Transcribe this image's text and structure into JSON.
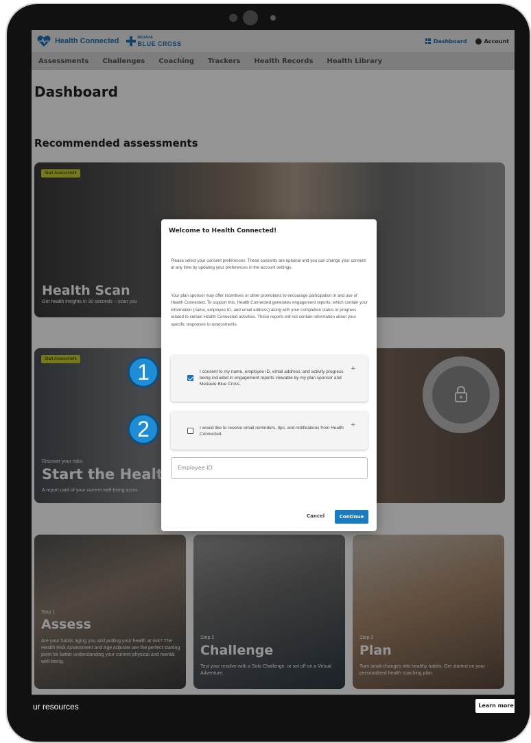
{
  "header": {
    "brand": "Health Connected",
    "partner_small": "MEDAVIE",
    "partner": "BLUE CROSS",
    "dashboard_link": "Dashboard",
    "account_link": "Account"
  },
  "nav": {
    "items": [
      "Assessments",
      "Challenges",
      "Coaching",
      "Trackers",
      "Health Records",
      "Health Library"
    ]
  },
  "page": {
    "title": "Dashboard",
    "section_title": "Recommended assessments"
  },
  "cards": {
    "health_scan": {
      "badge": "Start Assessment",
      "title": "Health Scan",
      "subtitle": "Get health insights in 30 seconds – scan you"
    },
    "hra": {
      "badge": "Start Assessment",
      "kicker": "Discover your risks",
      "title": "Start the Health R",
      "subtitle": "A report card of your current well-being acros"
    },
    "steps": [
      {
        "step": "Step 1",
        "title": "Assess",
        "text": "Are your habits aging you and putting your health at risk? The Health Risk Assessment and Age Adjuster are the perfect starting point for better understanding your current physical and mental well-being."
      },
      {
        "step": "Step 2",
        "title": "Challenge",
        "text": "Test your resolve with a Solo Challenge, or set off on a Virtual Adventure."
      },
      {
        "step": "Step 3",
        "title": "Plan",
        "text": "Turn small changes into healthy habits. Get started on your personalized health coaching plan."
      }
    ]
  },
  "resources": {
    "title": "ur resources",
    "learn_more": "Learn more"
  },
  "dialog": {
    "title": "Welcome to Health Connected!",
    "intro": "Please select your consent preferences. These consents are optional and you can change your consent at any time by updating your preferences in the account settings.",
    "body": "Your plan sponsor may offer incentives or other promotions to encourage participation in and use of Health Connected. To support this, Health Connected generates engagement reports, which contain your information (name, employee ID, and email address) along with your completion status or progress related to certain Health Connected activities. These reports will not contain information about your specific responses to assessments.",
    "consent1": {
      "text": "I consent to my name, employee ID, email address, and activity progress being included in engagement reports viewable by my plan sponsor and Medavie Blue Cross.",
      "checked": true
    },
    "consent2": {
      "text": "I would like to receive email reminders, tips, and notifications from Health Connected.",
      "checked": false
    },
    "employee_id_placeholder": "Employee ID",
    "cancel": "Cancel",
    "continue": "Continue",
    "expand_symbol": "+"
  },
  "callouts": [
    "1",
    "2"
  ],
  "colors": {
    "brand_blue": "#1f72b8",
    "continue_button": "#1a7bbf",
    "badge": "#c9d22b",
    "callout": "#1f8dd6"
  }
}
